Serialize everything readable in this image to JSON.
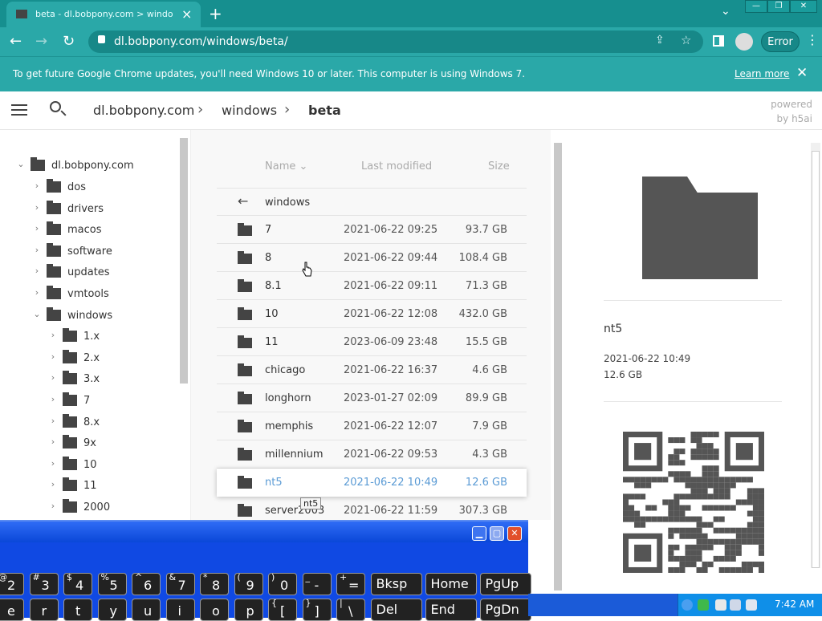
{
  "browser": {
    "tab_title": "beta - dl.bobpony.com > windows >",
    "tab_close": "×",
    "new_tab": "+",
    "tab_menu": "⌄",
    "window_min": "—",
    "window_restore": "❐",
    "window_close": "✕",
    "url": "dl.bobpony.com/windows/beta/",
    "error_label": "Error",
    "kebab": "⋮",
    "back": "←",
    "forward": "→",
    "reload": "↻",
    "share": "⇪",
    "star": "☆"
  },
  "infobar": {
    "message": "To get future Google Chrome updates, you'll need Windows 10 or later. This computer is using Windows 7.",
    "learn_more": "Learn more",
    "close": "✕"
  },
  "header": {
    "crumbs": [
      "dl.bobpony.com",
      "windows",
      "beta"
    ],
    "powered_line1": "powered",
    "powered_line2": "by h5ai"
  },
  "tree": {
    "root": "dl.bobpony.com",
    "items": [
      "dos",
      "drivers",
      "macos",
      "software",
      "updates",
      "vmtools",
      "windows"
    ],
    "windows_children": [
      "1.x",
      "2.x",
      "3.x",
      "7",
      "8.x",
      "9x",
      "10",
      "11",
      "2000"
    ]
  },
  "list": {
    "col_name": "Name",
    "col_modified": "Last modified",
    "col_size": "Size",
    "parent": "windows",
    "rows": [
      {
        "name": "7",
        "date": "2021-06-22 09:25",
        "size": "93.7 GB"
      },
      {
        "name": "8",
        "date": "2021-06-22 09:44",
        "size": "108.4 GB"
      },
      {
        "name": "8.1",
        "date": "2021-06-22 09:11",
        "size": "71.3 GB"
      },
      {
        "name": "10",
        "date": "2021-06-22 12:08",
        "size": "432.0 GB"
      },
      {
        "name": "11",
        "date": "2023-06-09 23:48",
        "size": "15.5 GB"
      },
      {
        "name": "chicago",
        "date": "2021-06-22 16:37",
        "size": "4.6 GB"
      },
      {
        "name": "longhorn",
        "date": "2023-01-27 02:09",
        "size": "89.9 GB"
      },
      {
        "name": "memphis",
        "date": "2021-06-22 12:07",
        "size": "7.9 GB"
      },
      {
        "name": "millennium",
        "date": "2021-06-22 09:53",
        "size": "4.3 GB"
      },
      {
        "name": "nt5",
        "date": "2021-06-22 10:49",
        "size": "12.6 GB"
      },
      {
        "name": "server2003",
        "date": "2021-06-22 11:59",
        "size": "307.3 GB"
      }
    ],
    "tooltip": "nt5"
  },
  "preview": {
    "name": "nt5",
    "date": "2021-06-22 10:49",
    "size": "12.6 GB"
  },
  "osk": {
    "row1": [
      {
        "sm": "@",
        "big": "2"
      },
      {
        "sm": "#",
        "big": "3"
      },
      {
        "sm": "$",
        "big": "4"
      },
      {
        "sm": "%",
        "big": "5"
      },
      {
        "sm": "^",
        "big": "6"
      },
      {
        "sm": "&",
        "big": "7"
      },
      {
        "sm": "*",
        "big": "8"
      },
      {
        "sm": "(",
        "big": "9"
      },
      {
        "sm": ")",
        "big": "0"
      },
      {
        "sm": "_",
        "big": "-"
      },
      {
        "sm": "+",
        "big": "="
      }
    ],
    "row1_wide": [
      "Bksp",
      "Home",
      "PgUp"
    ],
    "row2": [
      {
        "sm": "",
        "big": "e"
      },
      {
        "sm": "",
        "big": "r"
      },
      {
        "sm": "",
        "big": "t"
      },
      {
        "sm": "",
        "big": "y"
      },
      {
        "sm": "",
        "big": "u"
      },
      {
        "sm": "",
        "big": "i"
      },
      {
        "sm": "",
        "big": "o"
      },
      {
        "sm": "",
        "big": "p"
      },
      {
        "sm": "{",
        "big": "["
      },
      {
        "sm": "}",
        "big": "]"
      },
      {
        "sm": "|",
        "big": "\\"
      }
    ],
    "row2_wide": [
      "Del",
      "End",
      "PgDn"
    ]
  },
  "taskbar": {
    "clock": "7:42 AM"
  },
  "colors": {
    "chrome_frame": "#168f8f",
    "chrome_toolbar": "#2aa8a8",
    "selected_text": "#5b9bd5",
    "osk_blue": "#1049e3"
  }
}
